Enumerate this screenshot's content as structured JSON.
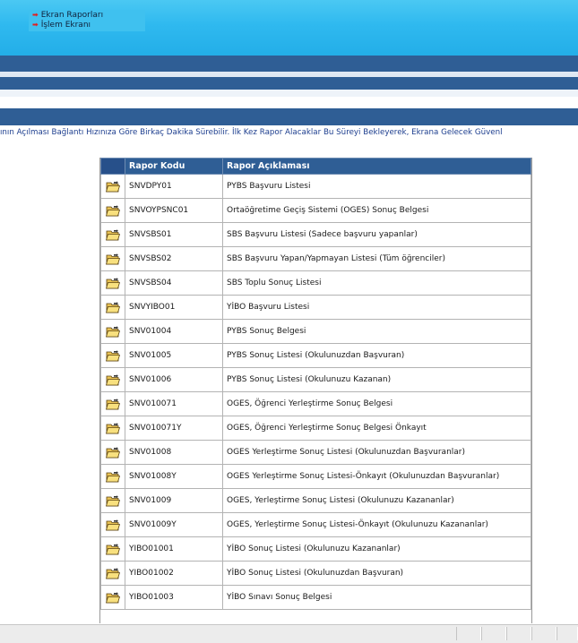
{
  "quick_links": [
    {
      "label": "Ekran Raporları"
    },
    {
      "label": "İşlem Ekranı"
    }
  ],
  "notice": "ının Açılması Bağlantı Hızınıza Göre Birkaç Dakika Sürebilir. İlk Kez Rapor Alacaklar Bu Süreyi Bekleyerek, Ekrana Gelecek Güvenl",
  "table": {
    "headers": {
      "code": "Rapor Kodu",
      "description": "Rapor Açıklaması"
    },
    "rows": [
      {
        "code": "SNVDPY01",
        "description": "PYBS Başvuru Listesi"
      },
      {
        "code": "SNVOYPSNC01",
        "description": "Ortaöğretime Geçiş Sistemi (OGES) Sonuç Belgesi"
      },
      {
        "code": "SNVSBS01",
        "description": "SBS Başvuru Listesi (Sadece başvuru yapanlar)"
      },
      {
        "code": "SNVSBS02",
        "description": "SBS Başvuru Yapan/Yapmayan Listesi (Tüm öğrenciler)"
      },
      {
        "code": "SNVSBS04",
        "description": "SBS Toplu Sonuç Listesi"
      },
      {
        "code": "SNVYIBO01",
        "description": "YİBO Başvuru Listesi"
      },
      {
        "code": "SNV01004",
        "description": "PYBS Sonuç Belgesi"
      },
      {
        "code": "SNV01005",
        "description": "PYBS Sonuç Listesi (Okulunuzdan Başvuran)"
      },
      {
        "code": "SNV01006",
        "description": "PYBS Sonuç Listesi (Okulunuzu Kazanan)"
      },
      {
        "code": "SNV010071",
        "description": "OGES, Öğrenci Yerleştirme Sonuç Belgesi"
      },
      {
        "code": "SNV010071Y",
        "description": "OGES, Öğrenci Yerleştirme Sonuç Belgesi Önkayıt"
      },
      {
        "code": "SNV01008",
        "description": "OGES Yerleştirme Sonuç Listesi (Okulunuzdan Başvuranlar)"
      },
      {
        "code": "SNV01008Y",
        "description": "OGES Yerleştirme Sonuç Listesi-Önkayıt (Okulunuzdan Başvuranlar)"
      },
      {
        "code": "SNV01009",
        "description": "OGES, Yerleştirme Sonuç Listesi (Okulunuzu Kazananlar)"
      },
      {
        "code": "SNV01009Y",
        "description": "OGES, Yerleştirme Sonuç Listesi-Önkayıt (Okulunuzu Kazananlar)"
      },
      {
        "code": "YIBO01001",
        "description": "YİBO Sonuç Listesi (Okulunuzu Kazananlar)"
      },
      {
        "code": "YIBO01002",
        "description": "YİBO Sonuç Listesi (Okulunuzdan Başvuran)"
      },
      {
        "code": "YIBO01003",
        "description": "YİBO Sınavı Sonuç Belgesi"
      }
    ]
  },
  "icons": {
    "row_action": "open-folder-icon",
    "bullet": "red-arrow-icon"
  },
  "colors": {
    "banner": "#2fb9ef",
    "nav_bar": "#2f5e95",
    "notice_text": "#1e3f8f",
    "bullet": "#e02020"
  }
}
